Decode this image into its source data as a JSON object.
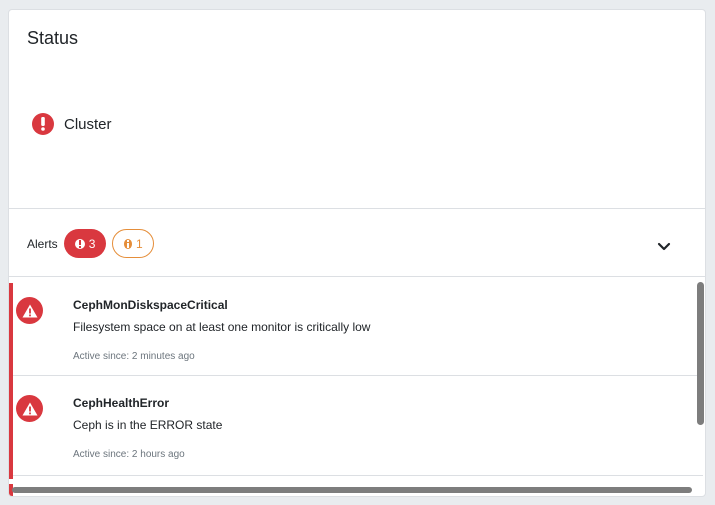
{
  "card": {
    "title": "Status"
  },
  "cluster": {
    "label": "Cluster",
    "status_color": "#d9383f",
    "icon": "exclamation-circle-icon"
  },
  "alerts": {
    "label": "Alerts",
    "critical_count": "3",
    "warning_count": "1",
    "colors": {
      "critical": "#d9383f",
      "warning": "#e58e3a"
    },
    "expand_icon": "chevron-down-icon",
    "items": [
      {
        "name": "CephMonDiskspaceCritical",
        "description": "Filesystem space on at least one monitor is critically low",
        "active_since": "Active since: 2 minutes ago",
        "severity": "critical"
      },
      {
        "name": "CephHealthError",
        "description": "Ceph is in the ERROR state",
        "active_since": "Active since: 2 hours ago",
        "severity": "critical"
      }
    ]
  }
}
